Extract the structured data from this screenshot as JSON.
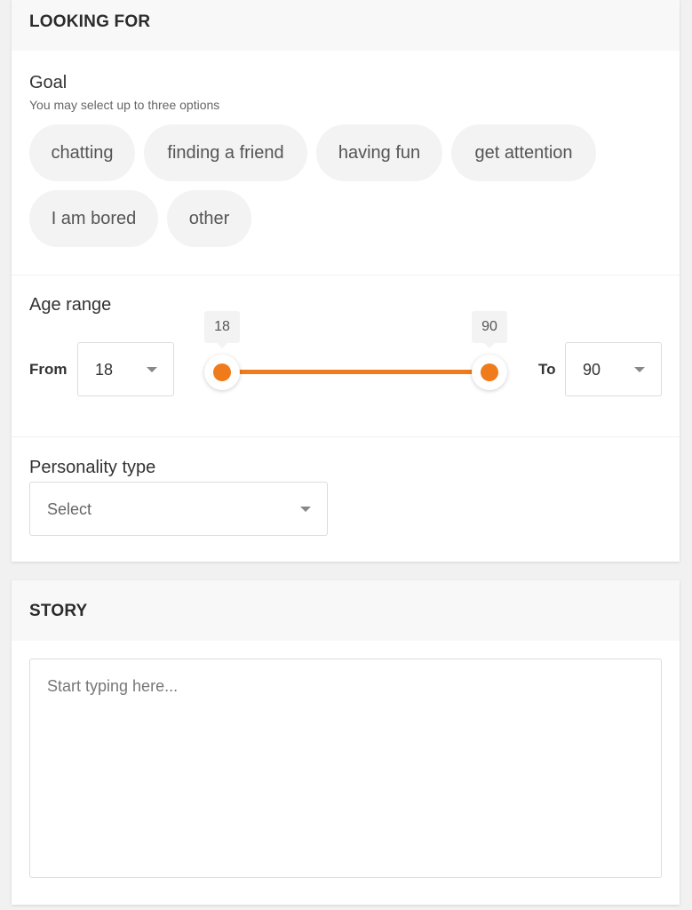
{
  "looking_for": {
    "title": "LOOKING FOR",
    "goal": {
      "label": "Goal",
      "hint": "You may select up to three options",
      "options": [
        "chatting",
        "finding a friend",
        "having fun",
        "get attention",
        "I am bored",
        "other"
      ]
    },
    "age_range": {
      "label": "Age range",
      "from_label": "From",
      "to_label": "To",
      "from_value": "18",
      "to_value": "90",
      "slider_min": "18",
      "slider_max": "90"
    },
    "personality": {
      "label": "Personality type",
      "placeholder": "Select"
    }
  },
  "story": {
    "title": "STORY",
    "placeholder": "Start typing here..."
  },
  "colors": {
    "accent": "#f07b1a",
    "chip_bg": "#f3f3f3",
    "page_bg": "#f1f1f1",
    "header_bg": "#f8f8f8"
  }
}
